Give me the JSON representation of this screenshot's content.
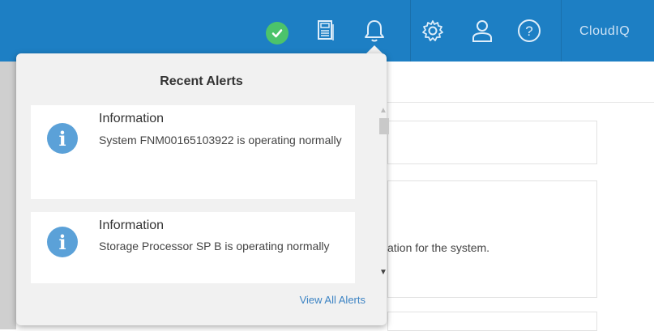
{
  "header": {
    "status": "ok",
    "logo_text": "CloudIQ",
    "icons": [
      "check-circle-icon",
      "news-icon",
      "bell-icon",
      "gear-icon",
      "user-icon",
      "help-icon"
    ],
    "colors": {
      "bar": "#1d7fc4",
      "status_ok": "#4cc36b"
    }
  },
  "popup": {
    "title": "Recent Alerts",
    "alerts": [
      {
        "title": "Information",
        "message": "System FNM00165103922 is operating normally",
        "icon": "info-icon"
      },
      {
        "title": "Information",
        "message": "Storage Processor SP B is operating normally",
        "icon": "info-icon"
      }
    ],
    "view_all_label": "View All Alerts"
  },
  "background": {
    "partial_text": "ation for the system."
  }
}
